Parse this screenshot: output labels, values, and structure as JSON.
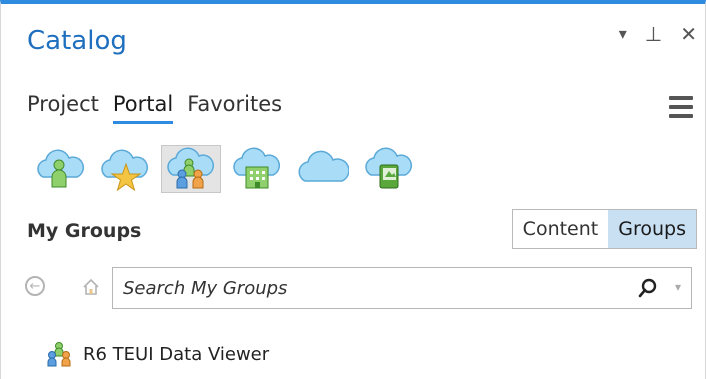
{
  "pane": {
    "title": "Catalog",
    "controls": {
      "options": "▾",
      "pin": "⊥",
      "close": "✕"
    }
  },
  "tabs": [
    {
      "label": "Project",
      "active": false
    },
    {
      "label": "Portal",
      "active": true
    },
    {
      "label": "Favorites",
      "active": false
    }
  ],
  "portal_icons": [
    {
      "name": "my-content-icon",
      "selected": false
    },
    {
      "name": "my-favorites-icon",
      "selected": false
    },
    {
      "name": "my-groups-icon",
      "selected": true
    },
    {
      "name": "my-organization-icon",
      "selected": false
    },
    {
      "name": "arcgis-online-icon",
      "selected": false
    },
    {
      "name": "living-atlas-icon",
      "selected": false
    }
  ],
  "section": {
    "title": "My Groups",
    "toggle": {
      "content_label": "Content",
      "groups_label": "Groups",
      "active": "Groups"
    }
  },
  "search": {
    "placeholder": "Search My Groups",
    "value": ""
  },
  "results": [
    {
      "label": "R6 TEUI Data Viewer",
      "icon": "group-icon"
    }
  ],
  "colors": {
    "accent": "#2e8be0",
    "title": "#1f6fbf",
    "toggle_active_bg": "#c9dff2",
    "icon_cloud": "#7cc3ee",
    "icon_green": "#5aa83c"
  }
}
